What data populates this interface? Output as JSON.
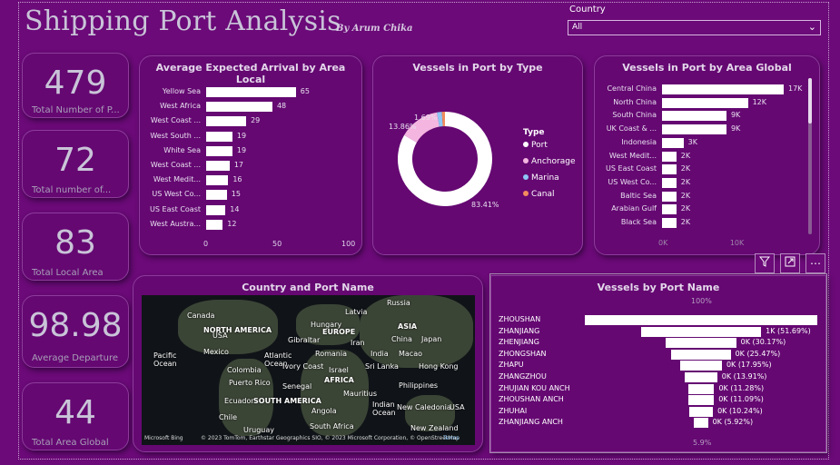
{
  "header": {
    "title": "Shipping Port Analysis",
    "byline": "By Arum Chika"
  },
  "slicer": {
    "label": "Country",
    "value": "All"
  },
  "kpis": [
    {
      "value": "479",
      "label": "Total Number of P..."
    },
    {
      "value": "72",
      "label": "Total number of..."
    },
    {
      "value": "83",
      "label": "Total Local Area"
    },
    {
      "value": "98.98",
      "label": "Average Departure"
    },
    {
      "value": "44",
      "label": "Total Area Global"
    }
  ],
  "cards": {
    "arrival": "Average Expected Arrival by Area Local",
    "type": "Vessels in Port by Type",
    "global": "Vessels in Port by Area Global",
    "map": "Country and Port Name",
    "funnel": "Vessels by Port Name"
  },
  "chart_data": [
    {
      "type": "bar",
      "title": "Average Expected Arrival by Area Local",
      "categories": [
        "Yellow Sea",
        "West Africa",
        "West Coast ...",
        "West South ...",
        "White Sea",
        "West Coast ...",
        "West Medit...",
        "US West Co...",
        "US East Coast",
        "West Austra..."
      ],
      "values": [
        65,
        48,
        29,
        19,
        19,
        17,
        16,
        15,
        14,
        12
      ],
      "xticks": [
        "0",
        "50",
        "100"
      ],
      "xlim": [
        0,
        100
      ]
    },
    {
      "type": "pie",
      "title": "Vessels in Port by Type",
      "legend_title": "Type",
      "categories": [
        "Port",
        "Anchorage",
        "Marina",
        "Canal"
      ],
      "values": [
        83.41,
        13.86,
        1.69,
        1.04
      ],
      "labels": [
        "83.41%",
        "13.86%",
        "1.69%"
      ],
      "colors": [
        "#ffffff",
        "#f4b6e0",
        "#8ec5f5",
        "#f28c5e"
      ]
    },
    {
      "type": "bar",
      "title": "Vessels in Port by Area Global",
      "categories": [
        "Central China",
        "North China",
        "South China",
        "UK Coast & ...",
        "Indonesia",
        "West Medit...",
        "US East Coast",
        "US West Co...",
        "Baltic Sea",
        "Arabian Gulf",
        "Black Sea"
      ],
      "values": [
        17,
        12,
        9,
        9,
        3,
        2,
        2,
        2,
        2,
        2,
        2
      ],
      "value_labels": [
        "17K",
        "12K",
        "9K",
        "9K",
        "3K",
        "2K",
        "2K",
        "2K",
        "2K",
        "2K",
        "2K"
      ],
      "xticks": [
        "0K",
        "10K"
      ],
      "xlim": [
        0,
        17
      ]
    },
    {
      "type": "bar",
      "title": "Vessels by Port Name",
      "categories": [
        "ZHOUSHAN",
        "ZHANJIANG",
        "ZHENJIANG",
        "ZHONGSHAN",
        "ZHAPU",
        "ZHANGZHOU",
        "ZHUJIAN KOU ANCH",
        "ZHOUSHAN ANCH",
        "ZHUHAI",
        "ZHANJIANG ANCH"
      ],
      "values": [
        100,
        51.69,
        30.17,
        25.47,
        17.95,
        13.91,
        11.28,
        11.09,
        10.24,
        5.92
      ],
      "value_labels": [
        "",
        "1K (51.69%)",
        "0K (30.17%)",
        "0K (25.47%)",
        "0K (17.95%)",
        "0K (13.91%)",
        "0K (11.28%)",
        "0K (11.09%)",
        "0K (10.24%)",
        "0K (5.92%)"
      ],
      "top_label": "100%",
      "bottom_label": "5.9%"
    }
  ],
  "map": {
    "labels": [
      "Russia",
      "Canada",
      "Latvia",
      "Hungary",
      "EUROPE",
      "NORTH AMERICA",
      "ASIA",
      "USA",
      "Gibraltar",
      "Iran",
      "China",
      "Japan",
      "Mexico",
      "Romania",
      "India",
      "Macao",
      "Pacific Ocean",
      "Atlantic Ocean",
      "Colombia",
      "Ivory Coast",
      "Israel",
      "Sri Lanka",
      "Hong Kong",
      "Puerto Rico",
      "Senegal",
      "AFRICA",
      "Philippines",
      "Mauritius",
      "Ecuador",
      "SOUTH AMERICA",
      "Indian Ocean",
      "New Caledonia",
      "USA",
      "Chile",
      "Angola",
      "Uruguay",
      "South Africa",
      "New Zealand"
    ],
    "attribution": "© 2023 TomTom, Earthstar Geographics SIO, © 2023 Microsoft Corporation, © OpenStreetMap",
    "terms": "Terms",
    "brand": "Microsoft Bing"
  },
  "toolbar": {
    "filter_icon": "filter-icon",
    "focus_icon": "focus-mode-icon",
    "more_icon": "more-options-icon"
  }
}
